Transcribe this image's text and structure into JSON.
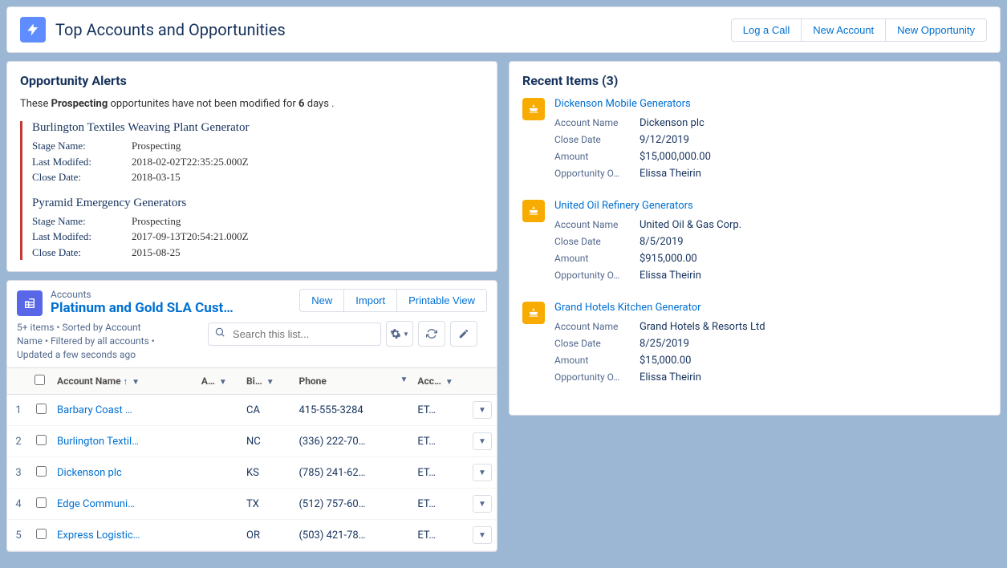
{
  "header": {
    "title": "Top Accounts and Opportunities",
    "buttons": {
      "log_call": "Log a Call",
      "new_account": "New Account",
      "new_opportunity": "New Opportunity"
    }
  },
  "alerts_card": {
    "title": "Opportunity Alerts",
    "intro_pre": "These ",
    "intro_bold1": "Prospecting",
    "intro_mid": " opportunites have not been modified for ",
    "intro_bold2": "6",
    "intro_post": " days .",
    "labels": {
      "stage": "Stage Name:",
      "modified": "Last Modifed:",
      "close": "Close Date:"
    },
    "items": [
      {
        "title": "Burlington Textiles Weaving Plant Generator",
        "stage": "Prospecting",
        "modified": "2018-02-02T22:35:25.000Z",
        "close": "2018-03-15"
      },
      {
        "title": "Pyramid Emergency Generators",
        "stage": "Prospecting",
        "modified": "2017-09-13T20:54:21.000Z",
        "close": "2015-08-25"
      }
    ]
  },
  "list": {
    "object": "Accounts",
    "name": "Platinum and Gold SLA Cust…",
    "buttons": {
      "new": "New",
      "import": "Import",
      "print": "Printable View"
    },
    "meta_line1": "5+ items • Sorted by Account",
    "meta_line2": "Name • Filtered by all accounts •",
    "meta_line3": "Updated a few seconds ago",
    "search_placeholder": "Search this list...",
    "columns": {
      "name": "Account Name",
      "a": "A…",
      "b": "Bi…",
      "phone": "Phone",
      "owner": "Acc…"
    },
    "rows": [
      {
        "num": "1",
        "name": "Barbary Coast …",
        "a": "",
        "b": "CA",
        "phone": "415-555-3284",
        "owner": "ET…"
      },
      {
        "num": "2",
        "name": "Burlington Textil…",
        "a": "",
        "b": "NC",
        "phone": "(336) 222-70…",
        "owner": "ET…"
      },
      {
        "num": "3",
        "name": "Dickenson plc",
        "a": "",
        "b": "KS",
        "phone": "(785) 241-62…",
        "owner": "ET…"
      },
      {
        "num": "4",
        "name": "Edge Communi…",
        "a": "",
        "b": "TX",
        "phone": "(512) 757-60…",
        "owner": "ET…"
      },
      {
        "num": "5",
        "name": "Express Logistic…",
        "a": "",
        "b": "OR",
        "phone": "(503) 421-78…",
        "owner": "ET…"
      }
    ]
  },
  "recent": {
    "title": "Recent Items (3)",
    "labels": {
      "account": "Account Name",
      "close": "Close Date",
      "amount": "Amount",
      "owner": "Opportunity O…"
    },
    "items": [
      {
        "title": "Dickenson Mobile Generators",
        "account": "Dickenson plc",
        "close": "9/12/2019",
        "amount": "$15,000,000.00",
        "owner": "Elissa Theirin"
      },
      {
        "title": "United Oil Refinery Generators",
        "account": "United Oil & Gas Corp.",
        "close": "8/5/2019",
        "amount": "$915,000.00",
        "owner": "Elissa Theirin"
      },
      {
        "title": "Grand Hotels Kitchen Generator",
        "account": "Grand Hotels & Resorts Ltd",
        "close": "8/25/2019",
        "amount": "$15,000.00",
        "owner": "Elissa Theirin"
      }
    ]
  }
}
